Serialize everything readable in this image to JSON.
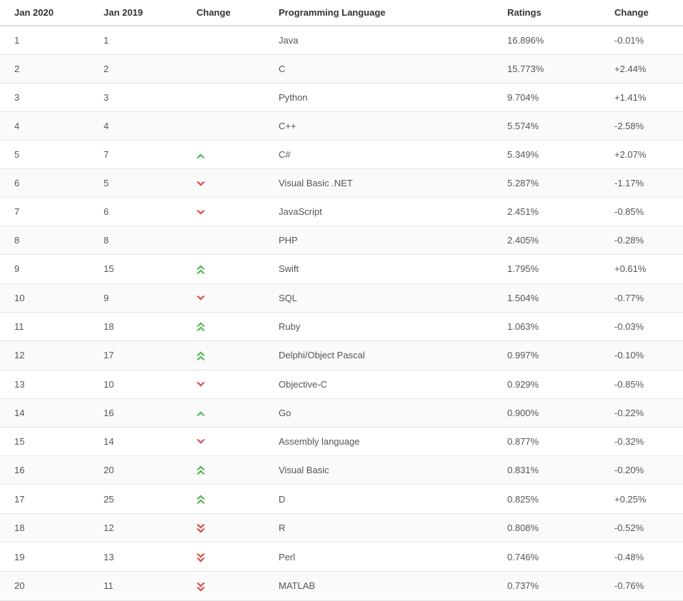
{
  "chart_data": {
    "type": "table",
    "title": "",
    "columns": [
      "Jan 2020",
      "Jan 2019",
      "Change",
      "Programming Language",
      "Ratings",
      "Change"
    ],
    "rows": [
      {
        "rank2020": "1",
        "rank2019": "1",
        "trend": "",
        "language": "Java",
        "ratings": "16.896%",
        "change": "-0.01%"
      },
      {
        "rank2020": "2",
        "rank2019": "2",
        "trend": "",
        "language": "C",
        "ratings": "15.773%",
        "change": "+2.44%"
      },
      {
        "rank2020": "3",
        "rank2019": "3",
        "trend": "",
        "language": "Python",
        "ratings": "9.704%",
        "change": "+1.41%"
      },
      {
        "rank2020": "4",
        "rank2019": "4",
        "trend": "",
        "language": "C++",
        "ratings": "5.574%",
        "change": "-2.58%"
      },
      {
        "rank2020": "5",
        "rank2019": "7",
        "trend": "up",
        "language": "C#",
        "ratings": "5.349%",
        "change": "+2.07%"
      },
      {
        "rank2020": "6",
        "rank2019": "5",
        "trend": "down",
        "language": "Visual Basic .NET",
        "ratings": "5.287%",
        "change": "-1.17%"
      },
      {
        "rank2020": "7",
        "rank2019": "6",
        "trend": "down",
        "language": "JavaScript",
        "ratings": "2.451%",
        "change": "-0.85%"
      },
      {
        "rank2020": "8",
        "rank2019": "8",
        "trend": "",
        "language": "PHP",
        "ratings": "2.405%",
        "change": "-0.28%"
      },
      {
        "rank2020": "9",
        "rank2019": "15",
        "trend": "up-double",
        "language": "Swift",
        "ratings": "1.795%",
        "change": "+0.61%"
      },
      {
        "rank2020": "10",
        "rank2019": "9",
        "trend": "down",
        "language": "SQL",
        "ratings": "1.504%",
        "change": "-0.77%"
      },
      {
        "rank2020": "11",
        "rank2019": "18",
        "trend": "up-double",
        "language": "Ruby",
        "ratings": "1.063%",
        "change": "-0.03%"
      },
      {
        "rank2020": "12",
        "rank2019": "17",
        "trend": "up-double",
        "language": "Delphi/Object Pascal",
        "ratings": "0.997%",
        "change": "-0.10%"
      },
      {
        "rank2020": "13",
        "rank2019": "10",
        "trend": "down",
        "language": "Objective-C",
        "ratings": "0.929%",
        "change": "-0.85%"
      },
      {
        "rank2020": "14",
        "rank2019": "16",
        "trend": "up",
        "language": "Go",
        "ratings": "0.900%",
        "change": "-0.22%"
      },
      {
        "rank2020": "15",
        "rank2019": "14",
        "trend": "down",
        "language": "Assembly language",
        "ratings": "0.877%",
        "change": "-0.32%"
      },
      {
        "rank2020": "16",
        "rank2019": "20",
        "trend": "up-double",
        "language": "Visual Basic",
        "ratings": "0.831%",
        "change": "-0.20%"
      },
      {
        "rank2020": "17",
        "rank2019": "25",
        "trend": "up-double",
        "language": "D",
        "ratings": "0.825%",
        "change": "+0.25%"
      },
      {
        "rank2020": "18",
        "rank2019": "12",
        "trend": "down-double",
        "language": "R",
        "ratings": "0.808%",
        "change": "-0.52%"
      },
      {
        "rank2020": "19",
        "rank2019": "13",
        "trend": "down-double",
        "language": "Perl",
        "ratings": "0.746%",
        "change": "-0.48%"
      },
      {
        "rank2020": "20",
        "rank2019": "11",
        "trend": "down-double",
        "language": "MATLAB",
        "ratings": "0.737%",
        "change": "-0.76%"
      }
    ]
  },
  "colors": {
    "up": "#5cb85c",
    "down": "#d9534f"
  }
}
